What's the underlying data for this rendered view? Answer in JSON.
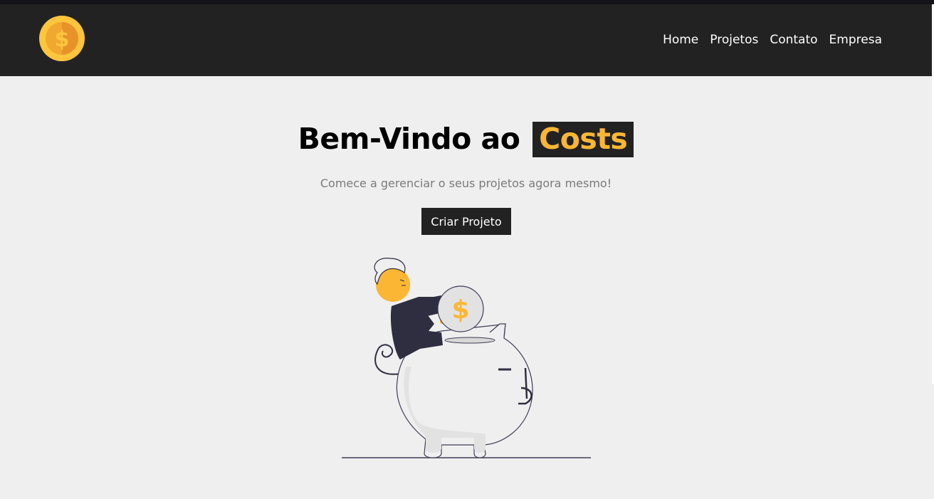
{
  "nav": {
    "logo_icon": "coin-dollar-icon",
    "links": [
      {
        "label": "Home"
      },
      {
        "label": "Projetos"
      },
      {
        "label": "Contato"
      },
      {
        "label": "Empresa"
      }
    ]
  },
  "hero": {
    "title_prefix": "Bem-Vindo ao",
    "title_brand": "Costs",
    "subtitle": "Comece a gerenciar o seus projetos agora mesmo!",
    "cta_label": "Criar Projeto",
    "illustration_icon": "piggy-bank-savings-illustration"
  },
  "colors": {
    "navbar": "#222222",
    "accent": "#fbb733",
    "background": "#efefef"
  }
}
